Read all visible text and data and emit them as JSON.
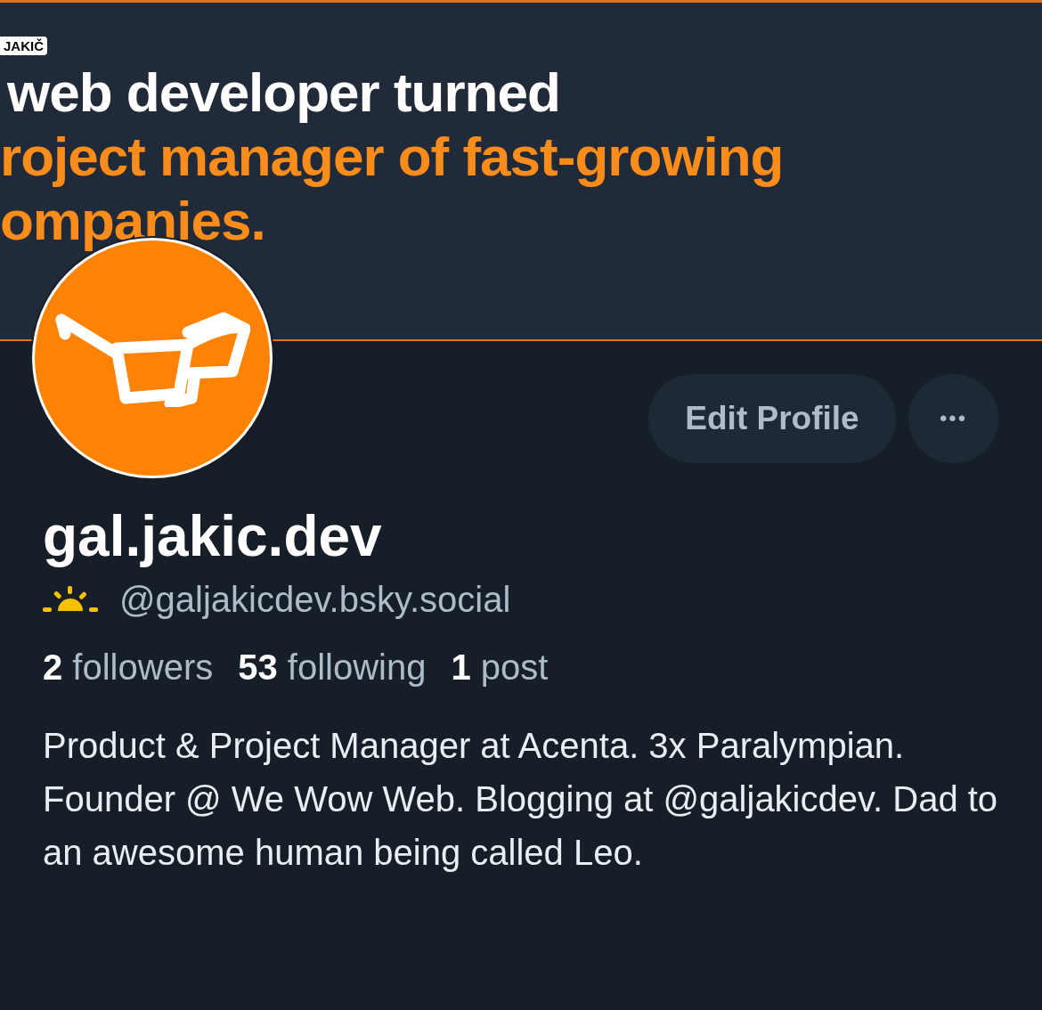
{
  "banner": {
    "badge": "JAKIČ",
    "lines": [
      {
        "text": "web developer turned",
        "accent": false
      },
      {
        "text": "roject manager of fast-growing",
        "accent": true
      },
      {
        "text": "ompanies.",
        "accent": true
      }
    ]
  },
  "actions": {
    "edit_button": "Edit Profile",
    "more_button": "•••"
  },
  "profile": {
    "display_name": "gal.jakic.dev",
    "handle": "@galjakicdev.bsky.social",
    "stats": [
      {
        "count": "2",
        "label": "followers"
      },
      {
        "count": "53",
        "label": "following"
      },
      {
        "count": "1",
        "label": "post"
      }
    ],
    "bio": "Product & Project Manager at Acenta. 3x Paralympian. Founder @ We Wow Web. Blogging at @galjakicdev. Dad to an awesome human being called Leo."
  }
}
